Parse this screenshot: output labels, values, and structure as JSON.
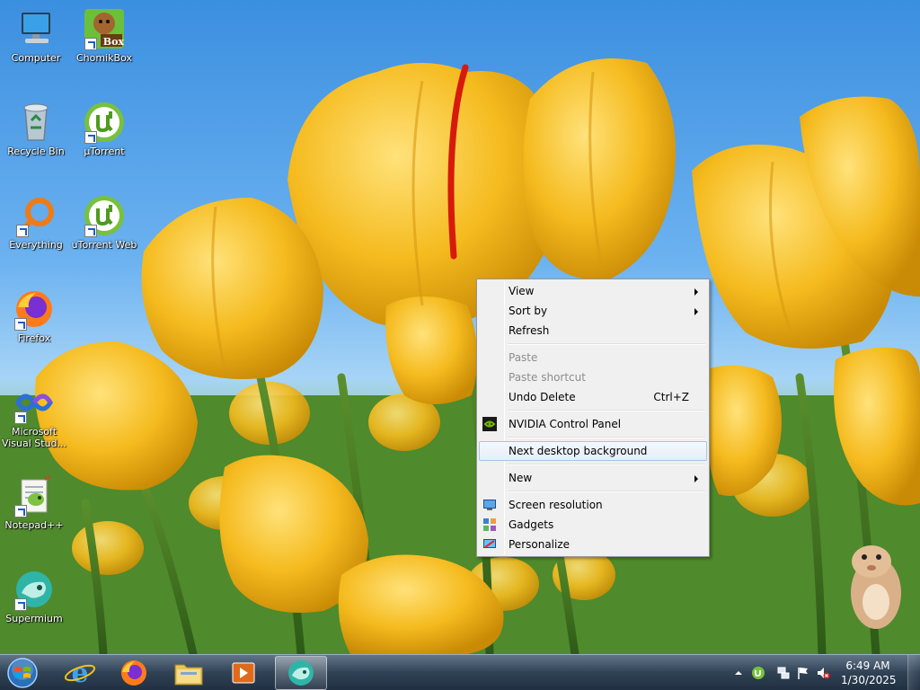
{
  "desktop_icons": [
    {
      "label": "Computer",
      "icon": "computer-icon",
      "shortcut": false
    },
    {
      "label": "ChomikBox",
      "icon": "chomikbox-icon",
      "shortcut": true,
      "badge": "Box"
    },
    {
      "label": "Recycle Bin",
      "icon": "recycle-bin-icon",
      "shortcut": false
    },
    {
      "label": "µTorrent",
      "icon": "utorrent-icon",
      "shortcut": true
    },
    {
      "label": "Everything",
      "icon": "everything-icon",
      "shortcut": true
    },
    {
      "label": "uTorrent Web",
      "icon": "utorrent-web-icon",
      "shortcut": true
    },
    {
      "label": "Firefox",
      "icon": "firefox-icon",
      "shortcut": true
    },
    {
      "label": "Microsoft Visual Stud...",
      "icon": "visual-studio-icon",
      "shortcut": true
    },
    {
      "label": "Notepad++",
      "icon": "notepadpp-icon",
      "shortcut": true
    },
    {
      "label": "Supermium",
      "icon": "supermium-icon",
      "shortcut": true
    }
  ],
  "context_menu": {
    "view": "View",
    "sort_by": "Sort by",
    "refresh": "Refresh",
    "paste": "Paste",
    "paste_shortcut": "Paste shortcut",
    "undo_delete": "Undo Delete",
    "undo_shortcut": "Ctrl+Z",
    "nvidia": "NVIDIA Control Panel",
    "next_background": "Next desktop background",
    "new": "New",
    "screen_resolution": "Screen resolution",
    "gadgets": "Gadgets",
    "personalize": "Personalize"
  },
  "taskbar": {
    "pinned": [
      "internet-explorer-icon",
      "firefox-icon",
      "file-explorer-icon",
      "media-player-icon",
      "supermium-icon"
    ],
    "active": "supermium-icon"
  },
  "tray": {
    "time": "6:49 AM",
    "date": "1/30/2025",
    "icons": [
      "show-hidden-icons",
      "utorrent-icon",
      "network-icon",
      "action-center-flag-icon",
      "volume-muted-icon"
    ]
  },
  "colors": {
    "menu_bg": "#f0f0f0",
    "menu_hover_border": "#a8c4e8",
    "taskbar": "#283a4e",
    "disabled_text": "#8d8d8d"
  }
}
